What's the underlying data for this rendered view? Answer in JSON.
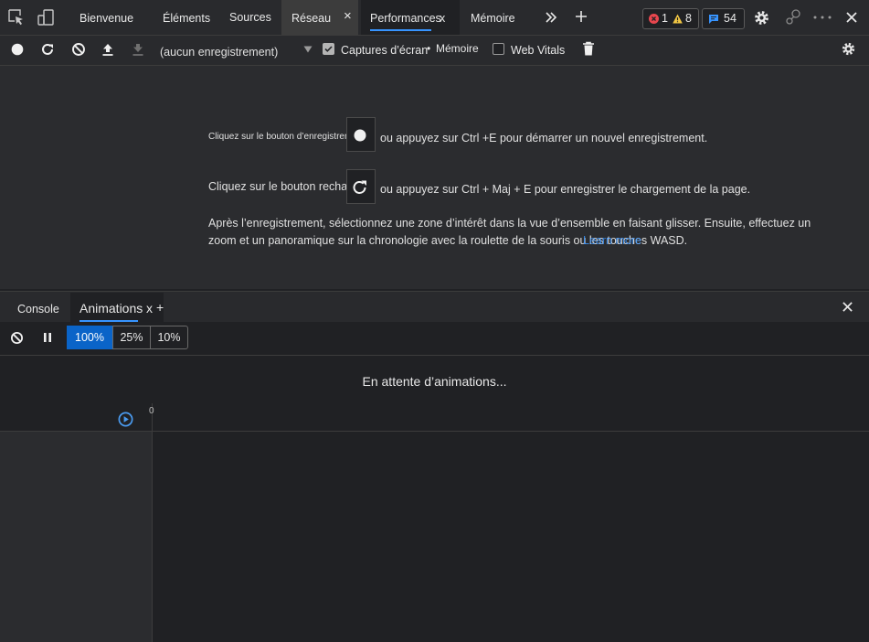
{
  "tabs": {
    "welcome": "Bienvenue",
    "elements": "Éléments",
    "sources": "Sources",
    "network": "Réseau",
    "performance": "Performances",
    "performance_close": "x",
    "memory": "Mémoire",
    "close_glyph": "×"
  },
  "status": {
    "errors": "1",
    "warnings": "8",
    "issues": "54"
  },
  "toolbar": {
    "recording_select": "(aucun enregistrement)",
    "screenshots_label": "Captures d’écran",
    "memory_label": "Mémoire",
    "webvitals_label": "Web Vitals"
  },
  "landing": {
    "record_before": "Cliquez sur le bouton d’enregistrement",
    "record_after": "ou appuyez sur Ctrl +E pour démarrer un nouvel enregistrement.",
    "reload_before": "Cliquez sur le bouton recharger",
    "reload_after": "ou appuyez sur Ctrl + Maj + E pour enregistrer le chargement de la page.",
    "para_line1": "Après l’enregistrement, sélectionnez une zone d’intérêt dans la vue d’ensemble en faisant glisser. Ensuite, effectuez un",
    "para_line2": "zoom et un panoramique sur la chronologie avec la roulette de la souris ou les touches WASD.",
    "learn_more": "Learn more"
  },
  "drawer": {
    "console": "Console",
    "animations": "Animations",
    "animations_close": "x",
    "add": "+"
  },
  "animations": {
    "speeds": [
      "100%",
      "25%",
      "10%"
    ],
    "selected_speed": "100%",
    "waiting": "En attente d’animations...",
    "timeline_zero": "0"
  },
  "colors": {
    "accent": "#3794ff",
    "selected_speed_bg": "#0a64c8",
    "error": "#e8464e",
    "warning": "#f2c744"
  }
}
